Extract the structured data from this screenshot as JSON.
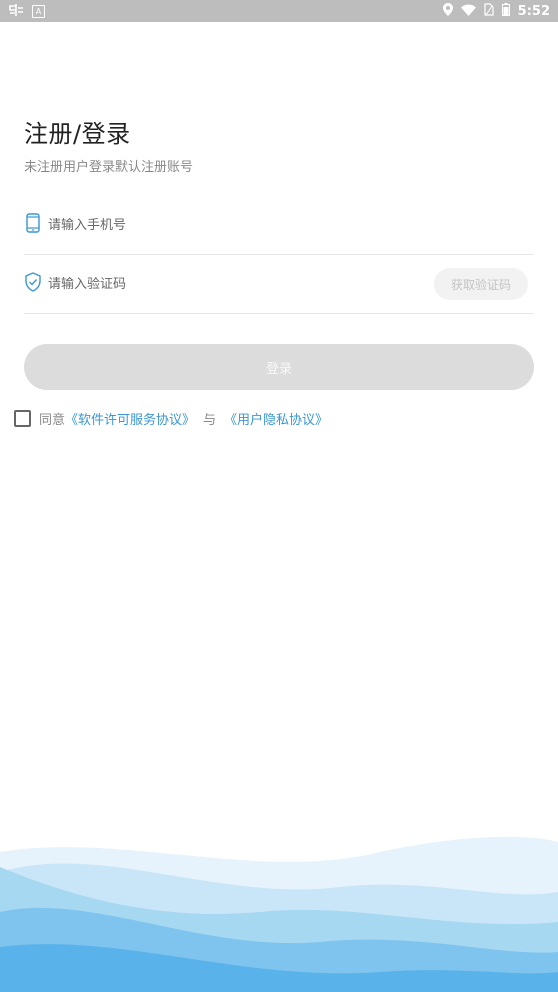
{
  "status_bar": {
    "time": "5:52",
    "left_icons": [
      "app-notification-icon",
      "a-notification-icon"
    ],
    "right_icons": [
      "location-icon",
      "wifi-icon",
      "sim-icon",
      "battery-icon"
    ]
  },
  "header": {
    "title": "注册/登录",
    "subtitle": "未注册用户登录默认注册账号"
  },
  "form": {
    "phone_placeholder": "请输入手机号",
    "code_placeholder": "请输入验证码",
    "get_code_label": "获取验证码",
    "login_label": "登录"
  },
  "agreement": {
    "prefix": "同意",
    "link1": "《软件许可服务协议》",
    "connector": "与",
    "link2": "《用户隐私协议》",
    "checked": false
  },
  "colors": {
    "accent": "#3a97d4",
    "button_disabled": "#dcdcdc",
    "status_bar": "#bdbdbd"
  }
}
